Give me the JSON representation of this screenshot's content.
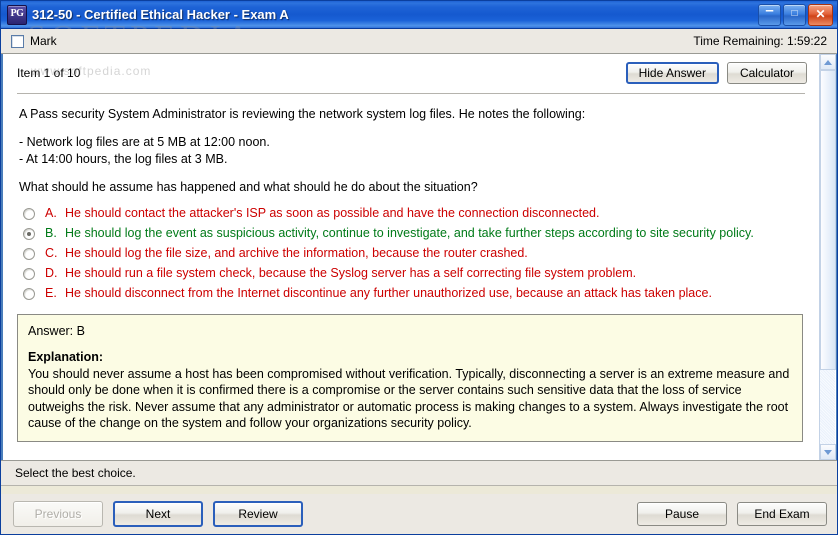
{
  "window": {
    "title": "312-50 - Certified Ethical Hacker - Exam A",
    "icon_label": "PG",
    "controls": {
      "minimize": "–",
      "maximize": "□",
      "close": "✕"
    }
  },
  "toolbar": {
    "mark_label": "Mark",
    "time_label": "Time Remaining: 1:59:22"
  },
  "watermark": {
    "main": "SOFTPEDIA",
    "sub": "www.softpedia.com"
  },
  "main": {
    "item_label": "Item 1 of 10",
    "hide_answer_label": "Hide Answer",
    "calculator_label": "Calculator",
    "question": {
      "intro": "A Pass security System Administrator is reviewing the network system log files. He notes the following:",
      "bullets": [
        "- Network log files are at 5 MB at 12:00 noon.",
        "- At 14:00 hours, the log files at 3 MB."
      ],
      "prompt": "What should he assume has happened and what should he do about the situation?"
    },
    "options": [
      {
        "letter": "A.",
        "text": "He should contact the attacker's ISP as soon as possible and have the connection disconnected.",
        "selected": false,
        "color": "#cc0000"
      },
      {
        "letter": "B.",
        "text": "He should log the event as suspicious activity, continue to investigate, and take further steps according to site security policy.",
        "selected": true,
        "color": "#007a18"
      },
      {
        "letter": "C.",
        "text": "He should log the file size, and archive the information, because the router crashed.",
        "selected": false,
        "color": "#cc0000"
      },
      {
        "letter": "D.",
        "text": "He should run a file system check, because the Syslog server has a self correcting file system problem.",
        "selected": false,
        "color": "#cc0000"
      },
      {
        "letter": "E.",
        "text": "He should disconnect from the Internet discontinue any further unauthorized use, because an attack has taken place.",
        "selected": false,
        "color": "#cc0000"
      }
    ],
    "explanation": {
      "answer_line": "Answer: B",
      "heading": "Explanation:",
      "body": "You should never assume a host has been compromised without verification. Typically, disconnecting a server is an extreme measure and should only be done when it is confirmed there is a compromise or the server contains such sensitive data that the loss of service outweighs the risk. Never assume that any administrator or automatic process is making changes to a system. Always investigate the root cause of the change on the system and follow your organizations security policy."
    }
  },
  "statusbar": {
    "message": "Select the best choice."
  },
  "footer": {
    "previous_label": "Previous",
    "next_label": "Next",
    "review_label": "Review",
    "pause_label": "Pause",
    "end_exam_label": "End Exam"
  }
}
